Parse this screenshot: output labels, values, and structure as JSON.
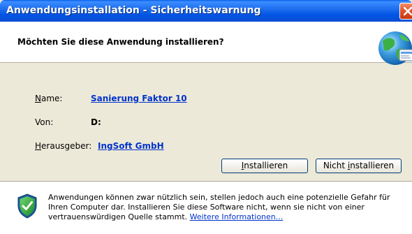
{
  "window": {
    "title": "Anwendungsinstallation - Sicherheitswarnung"
  },
  "header": {
    "question": "Möchten Sie diese Anwendung installieren?"
  },
  "details": {
    "name_label_mnemonic": "N",
    "name_label_rest": "ame:",
    "name_value": "Sanierung Faktor 10",
    "from_label": "Von:",
    "from_value": "D:",
    "publisher_label_mnemonic": "H",
    "publisher_label_rest": "erausgeber:",
    "publisher_value": "IngSoft GmbH"
  },
  "buttons": {
    "install_mnemonic": "I",
    "install_rest": "nstallieren",
    "cancel_prefix": "Nicht ",
    "cancel_mnemonic": "i",
    "cancel_rest": "nstallieren"
  },
  "warning": {
    "text": "Anwendungen können zwar nützlich sein, stellen jedoch auch eine potenzielle Gefahr für Ihren Computer dar. Installieren Sie diese Software nicht, wenn sie nicht von einer vertrauenswürdigen Quelle stammt. ",
    "link": "Weitere Informationen..."
  },
  "colors": {
    "titlebar": "#0054e3",
    "link": "#0033cc",
    "dialog_bg": "#ece9d8"
  },
  "icons": {
    "close": "close-x-icon",
    "globe": "globe-install-icon",
    "shield": "security-shield-icon"
  }
}
